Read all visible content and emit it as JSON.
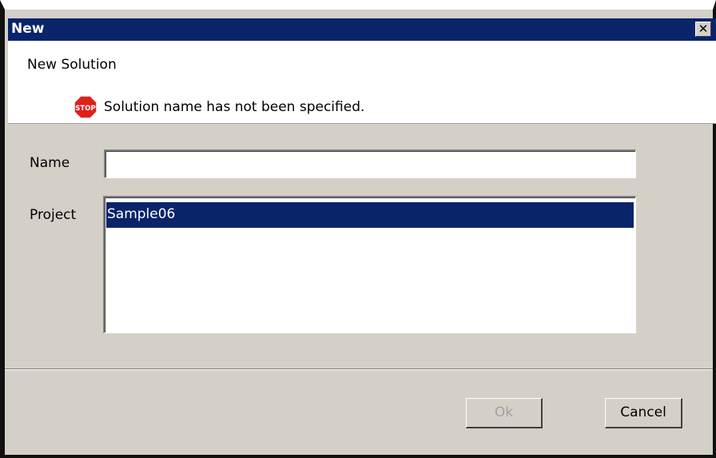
{
  "window": {
    "title": "New",
    "close_glyph": "✕"
  },
  "header": {
    "title": "New Solution",
    "error_icon": "stop-sign-icon",
    "error_icon_text": "STOP",
    "error_message": "Solution name has not been specified."
  },
  "form": {
    "name_label": "Name",
    "name_value": "",
    "project_label": "Project",
    "projects": [
      "Sample06"
    ],
    "selected_project": "Sample06"
  },
  "buttons": {
    "ok_label": "Ok",
    "ok_enabled": false,
    "cancel_label": "Cancel"
  },
  "colors": {
    "titlebar": "#0a246a",
    "selection": "#0a246a",
    "dialog_bg": "#d4d0c8",
    "stop_red": "#e0201b"
  }
}
